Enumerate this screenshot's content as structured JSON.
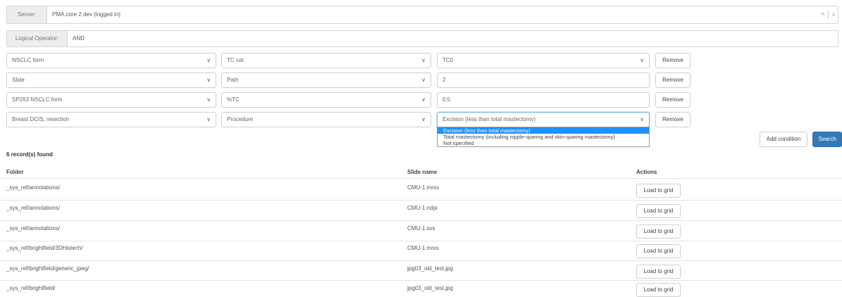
{
  "server": {
    "label": "Server:",
    "value": "PMA.core 2 dev (logged in)",
    "clear_icon": "×"
  },
  "operator": {
    "label": "Logical Operator:",
    "value": "AND"
  },
  "conditions": [
    {
      "form": "NSCLC form",
      "field": "TC cat",
      "value": "TC0",
      "value_is_select": true,
      "remove": "Remove"
    },
    {
      "form": "Slide",
      "field": "Path",
      "value": "2",
      "value_is_select": false,
      "remove": "Remove"
    },
    {
      "form": "SP263 NSCLC form",
      "field": "%TC",
      "value": "0.5",
      "value_is_select": false,
      "remove": "Remove"
    },
    {
      "form": "Breast DCIS, resection",
      "field": "Procedure",
      "value": "Excision (less than total mastectomy)",
      "value_is_select": true,
      "remove": "Remove"
    }
  ],
  "dropdown_options": [
    "Excision (less than total mastectomy)",
    "Total mastectomy (including nipple-sparing and skin-sparing mastectomy)",
    "Not specified"
  ],
  "dropdown_selected_index": 0,
  "add_condition_label": "Add condition",
  "search_label": "Search",
  "records_found": "6 record(s) found",
  "table": {
    "headers": [
      "Folder",
      "Slide name",
      "Actions"
    ],
    "rows": [
      {
        "folder": "_sys_ref/annotations/",
        "slide": "CMU-1.mrxs",
        "action": "Load to grid"
      },
      {
        "folder": "_sys_ref/annotations/",
        "slide": "CMU-1.ndpi",
        "action": "Load to grid"
      },
      {
        "folder": "_sys_ref/annotations/",
        "slide": "CMU-1.svs",
        "action": "Load to grid"
      },
      {
        "folder": "_sys_ref/brightfield/3DHistech/",
        "slide": "CMU-1.mrxs",
        "action": "Load to grid"
      },
      {
        "folder": "_sys_ref/brightfield/generic_jpeg/",
        "slide": "jpg03_old_test.jpg",
        "action": "Load to grid"
      },
      {
        "folder": "_sys_ref/brightfield/",
        "slide": "jpg03_old_test.jpg",
        "action": "Load to grid"
      }
    ]
  },
  "colors": {
    "accent": "#337ab7",
    "dropdown_highlight": "#1e90ff"
  }
}
